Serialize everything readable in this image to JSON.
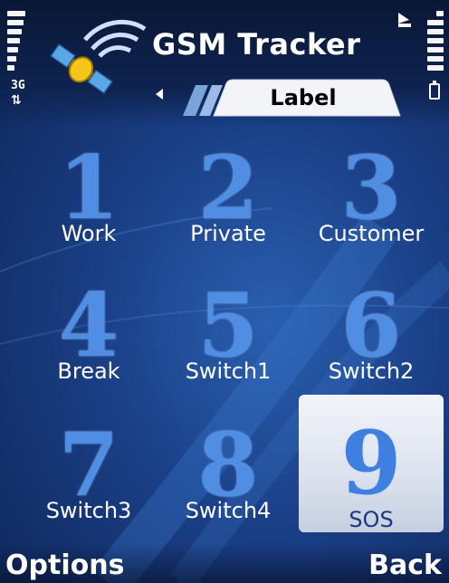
{
  "app": {
    "title": "GSM Tracker",
    "tab_label": "Label"
  },
  "status": {
    "network": "3G",
    "arrows": "⇅"
  },
  "keys": [
    {
      "digit": "1",
      "label": "Work"
    },
    {
      "digit": "2",
      "label": "Private"
    },
    {
      "digit": "3",
      "label": "Customer"
    },
    {
      "digit": "4",
      "label": "Break"
    },
    {
      "digit": "5",
      "label": "Switch1"
    },
    {
      "digit": "6",
      "label": "Switch2"
    },
    {
      "digit": "7",
      "label": "Switch3"
    },
    {
      "digit": "8",
      "label": "Switch4"
    },
    {
      "digit": "9",
      "label": "SOS"
    }
  ],
  "softkeys": {
    "left": "Options",
    "right": "Back"
  },
  "icons": {
    "logo": "satellite-icon",
    "battery": "battery-icon",
    "signal": "signal-strength-icon",
    "antenna": "antenna-icon"
  },
  "colors": {
    "accent": "#4f8ee2",
    "background": "#1a3f86",
    "selected": "#dbe2ee"
  }
}
